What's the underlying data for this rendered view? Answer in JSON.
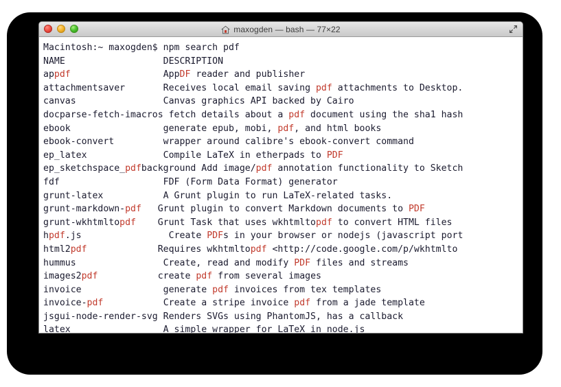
{
  "window": {
    "title": "maxogden — bash — 77×22",
    "title_icon": "house-icon",
    "fullscreen_icon": "fullscreen-arrows-icon",
    "traffic_lights": [
      {
        "name": "close-button",
        "color": "#f2554a"
      },
      {
        "name": "minimize-button",
        "color": "#f7b731"
      },
      {
        "name": "maximize-button",
        "color": "#4fc431"
      }
    ]
  },
  "theme": {
    "background": "#ffffff",
    "foreground": "#1a1a2e",
    "highlight": "#c1392b",
    "backdrop": "#000000"
  },
  "terminal": {
    "prompt": "Macintosh:~ maxogden$ ",
    "command": "npm search pdf",
    "columns": 77,
    "rows": 22,
    "header": {
      "name": "NAME",
      "description": "DESCRIPTION"
    },
    "lines": [
      {
        "segments": [
          {
            "t": "Macintosh:~ maxogden$ npm search pdf",
            "hl": false
          }
        ]
      },
      {
        "segments": [
          {
            "t": "NAME                  DESCRIPTION",
            "hl": false
          }
        ]
      },
      {
        "segments": [
          {
            "t": "ap",
            "hl": false
          },
          {
            "t": "pdf",
            "hl": true
          },
          {
            "t": "                 App",
            "hl": false
          },
          {
            "t": "DF",
            "hl": true
          },
          {
            "t": " reader and publisher",
            "hl": false
          }
        ]
      },
      {
        "segments": [
          {
            "t": "attachmentsaver       Receives local email saving ",
            "hl": false
          },
          {
            "t": "pdf",
            "hl": true
          },
          {
            "t": " attachments to Desktop.",
            "hl": false
          }
        ]
      },
      {
        "segments": [
          {
            "t": "canvas                Canvas graphics API backed by Cairo",
            "hl": false
          }
        ]
      },
      {
        "segments": [
          {
            "t": "docparse-fetch-imacros fetch details about a ",
            "hl": false
          },
          {
            "t": "pdf",
            "hl": true
          },
          {
            "t": " document using the sha1 hash",
            "hl": false
          }
        ]
      },
      {
        "segments": [
          {
            "t": "ebook                 generate epub, mobi, ",
            "hl": false
          },
          {
            "t": "pdf",
            "hl": true
          },
          {
            "t": ", and html books",
            "hl": false
          }
        ]
      },
      {
        "segments": [
          {
            "t": "ebook-convert         wrapper around calibre's ebook-convert command",
            "hl": false
          }
        ]
      },
      {
        "segments": [
          {
            "t": "ep_latex              Compile LaTeX in etherpads to ",
            "hl": false
          },
          {
            "t": "PDF",
            "hl": true
          }
        ]
      },
      {
        "segments": [
          {
            "t": "ep_sketchspace_",
            "hl": false
          },
          {
            "t": "pdf",
            "hl": true
          },
          {
            "t": "background Add image/",
            "hl": false
          },
          {
            "t": "pdf",
            "hl": true
          },
          {
            "t": " annotation functionality to Sketch",
            "hl": false
          }
        ]
      },
      {
        "segments": [
          {
            "t": "fdf                   FDF (Form Data Format) generator",
            "hl": false
          }
        ]
      },
      {
        "segments": [
          {
            "t": "grunt-latex           A Grunt plugin to run LaTeX-related tasks.",
            "hl": false
          }
        ]
      },
      {
        "segments": [
          {
            "t": "grunt-markdown-",
            "hl": false
          },
          {
            "t": "pdf",
            "hl": true
          },
          {
            "t": "   Grunt plugin to convert Markdown documents to ",
            "hl": false
          },
          {
            "t": "PDF",
            "hl": true
          }
        ]
      },
      {
        "segments": [
          {
            "t": "grunt-wkhtmlto",
            "hl": false
          },
          {
            "t": "pdf",
            "hl": true
          },
          {
            "t": "    Grunt Task that uses wkhtmlto",
            "hl": false
          },
          {
            "t": "pdf",
            "hl": true
          },
          {
            "t": " to convert HTML files",
            "hl": false
          }
        ]
      },
      {
        "segments": [
          {
            "t": "h",
            "hl": false
          },
          {
            "t": "pdf",
            "hl": true
          },
          {
            "t": ".js                Create ",
            "hl": false
          },
          {
            "t": "PDF",
            "hl": true
          },
          {
            "t": "s in your browser or nodejs (javascript port",
            "hl": false
          }
        ]
      },
      {
        "segments": [
          {
            "t": "html2",
            "hl": false
          },
          {
            "t": "pdf",
            "hl": true
          },
          {
            "t": "             Requires wkhtmlto",
            "hl": false
          },
          {
            "t": "pdf",
            "hl": true
          },
          {
            "t": " <http://code.google.com/p/wkhtmlto",
            "hl": false
          }
        ]
      },
      {
        "segments": [
          {
            "t": "hummus                Create, read and modify ",
            "hl": false
          },
          {
            "t": "PDF",
            "hl": true
          },
          {
            "t": " files and streams",
            "hl": false
          }
        ]
      },
      {
        "segments": [
          {
            "t": "images2",
            "hl": false
          },
          {
            "t": "pdf",
            "hl": true
          },
          {
            "t": "           create ",
            "hl": false
          },
          {
            "t": "pdf",
            "hl": true
          },
          {
            "t": " from several images",
            "hl": false
          }
        ]
      },
      {
        "segments": [
          {
            "t": "invoice               generate ",
            "hl": false
          },
          {
            "t": "pdf",
            "hl": true
          },
          {
            "t": " invoices from tex templates",
            "hl": false
          }
        ]
      },
      {
        "segments": [
          {
            "t": "invoice-",
            "hl": false
          },
          {
            "t": "pdf",
            "hl": true
          },
          {
            "t": "           Create a stripe invoice ",
            "hl": false
          },
          {
            "t": "pdf",
            "hl": true
          },
          {
            "t": " from a jade template",
            "hl": false
          }
        ]
      },
      {
        "segments": [
          {
            "t": "jsgui-node-render-svg Renders SVGs using PhantomJS, has a callback",
            "hl": false
          }
        ]
      },
      {
        "segments": [
          {
            "t": "latex                 A simple wrapper for LaTeX in node.js",
            "hl": false
          }
        ]
      }
    ]
  }
}
